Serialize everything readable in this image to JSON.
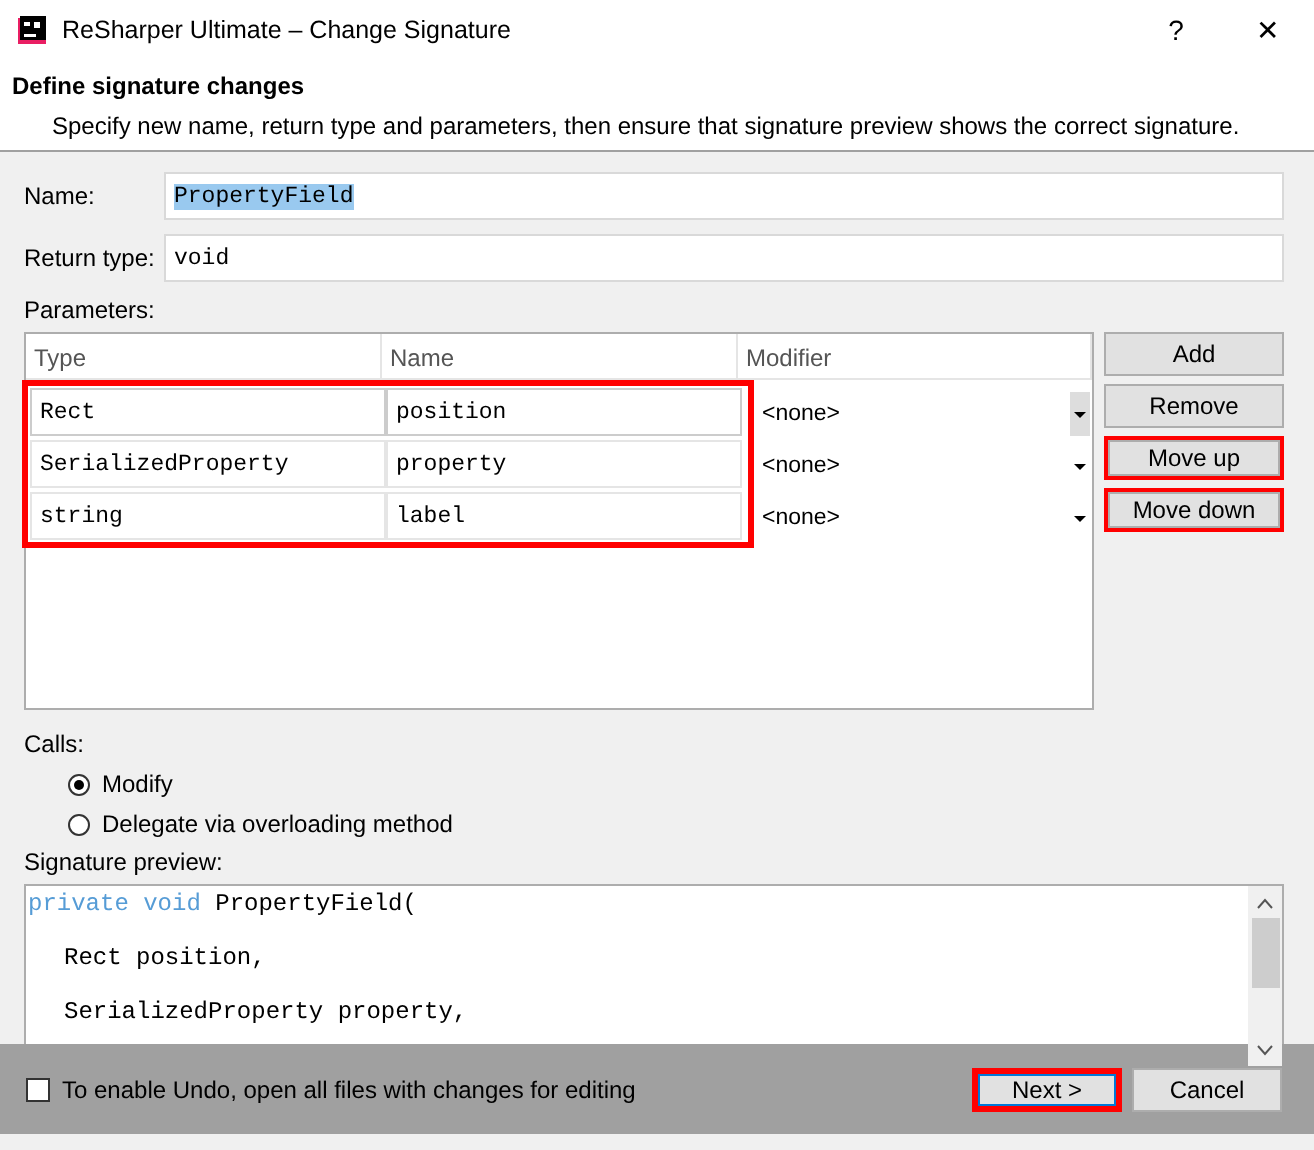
{
  "window": {
    "title": "ReSharper Ultimate – Change Signature",
    "help": "?",
    "close": "✕"
  },
  "header": {
    "title": "Define signature changes",
    "description": "Specify new name, return type and parameters, then ensure that signature preview shows the correct signature."
  },
  "name_field": {
    "label": "Name:",
    "value": "PropertyField",
    "selected_text": true
  },
  "return_type_field": {
    "label": "Return type:",
    "value": "void"
  },
  "parameters": {
    "label": "Parameters:",
    "highlighted": true,
    "columns": [
      "Type",
      "Name",
      "Modifier"
    ],
    "rows": [
      {
        "type": "Rect",
        "name": "position",
        "modifier": "<none>",
        "selected": true
      },
      {
        "type": "SerializedProperty",
        "name": "property",
        "modifier": "<none>",
        "selected": false
      },
      {
        "type": "string",
        "name": "label",
        "modifier": "<none>",
        "selected": false
      }
    ]
  },
  "side_buttons": [
    {
      "label": "Add",
      "highlighted": false
    },
    {
      "label": "Remove",
      "highlighted": false
    },
    {
      "label": "Move up",
      "highlighted": true
    },
    {
      "label": "Move down",
      "highlighted": true
    }
  ],
  "calls": {
    "label": "Calls:",
    "options": [
      {
        "label": "Modify",
        "selected": true
      },
      {
        "label": "Delegate via overloading method",
        "selected": false
      }
    ]
  },
  "preview": {
    "label": "Signature preview:",
    "lines": [
      {
        "keyword": "private void",
        "text": "PropertyField(",
        "children": [
          {
            "text": "Rect position,"
          },
          {
            "text": "SerializedProperty property,"
          }
        ]
      }
    ]
  },
  "footer": {
    "undo_checkbox": {
      "label": "To enable Undo, open all files with changes for editing",
      "checked": false
    },
    "buttons": [
      {
        "label": "Next >",
        "highlighted": true
      },
      {
        "label": "Cancel",
        "highlighted": false
      }
    ]
  }
}
